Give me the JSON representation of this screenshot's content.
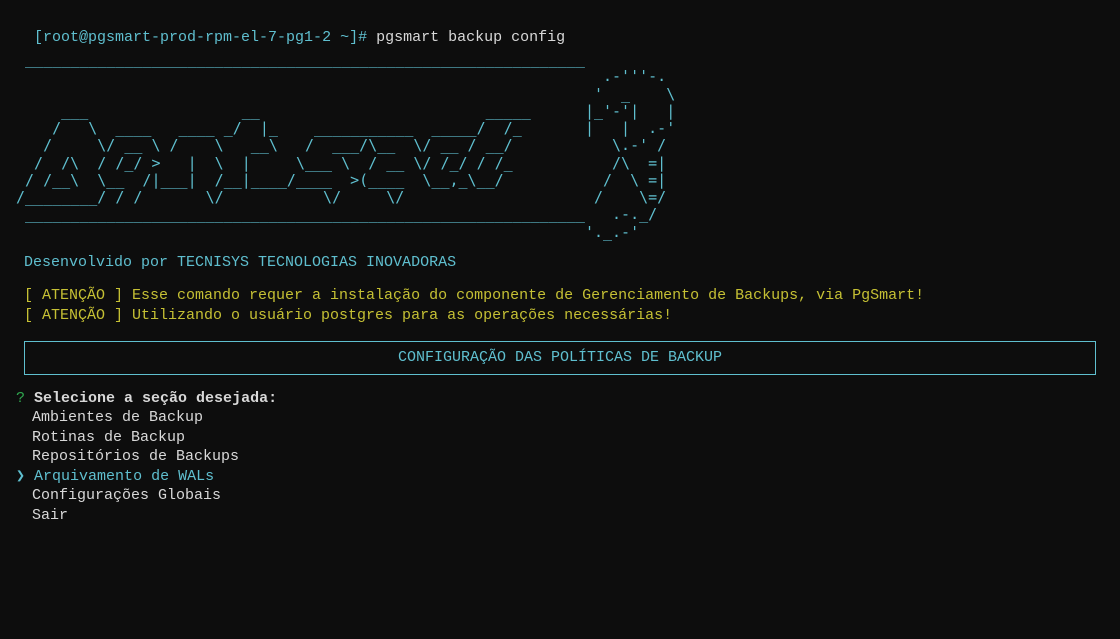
{
  "prompt": {
    "user_host": "[root@pgsmart-prod-rpm-el-7-pg1-2 ~]# ",
    "command": "pgsmart backup config"
  },
  "ascii_logo": " ______________________________________________________________\n                                                                 .-'''-.\n                                                                '  _    \\\n     ___                 __                         _____      |_'-'|   |\n    /   \\  ____   ____ _/  |_    ___________  _____/  /_       |   |  .-'\n   /     \\/ __ \\ /    \\   __\\   /  ___/\\__  \\/ __ / __/           \\.-' /\n  /  /\\  / /_/ >   |  \\  |     \\___ \\  / __ \\/ /_/ / /_           /\\  =|\n / /__\\  \\__  /|___|  /__|____/____  >(____  \\__,_\\__/           /  \\ =|\n/________/ / /       \\/           \\/     \\/                     /    \\=/\n ______________________________________________________________   .-._/\n                                                               '._.-'",
  "developer": "Desenvolvido por TECNISYS TECNOLOGIAS INOVADORAS",
  "warnings": [
    "[ ATENÇÃO ] Esse comando requer a instalação do componente de Gerenciamento de Backups, via PgSmart!",
    "[ ATENÇÃO ] Utilizando o usuário postgres para as operações necessárias!"
  ],
  "section_title": "CONFIGURAÇÃO DAS POLÍTICAS DE BACKUP",
  "menu": {
    "question_marker": "?",
    "question": "Selecione a seção desejada:",
    "selector": "❯",
    "items": [
      {
        "label": "Ambientes de Backup",
        "selected": false
      },
      {
        "label": "Rotinas de Backup",
        "selected": false
      },
      {
        "label": "Repositórios de Backups",
        "selected": false
      },
      {
        "label": "Arquivamento de WALs",
        "selected": true
      },
      {
        "label": "Configurações Globais",
        "selected": false
      },
      {
        "label": "Sair",
        "selected": false
      }
    ]
  }
}
